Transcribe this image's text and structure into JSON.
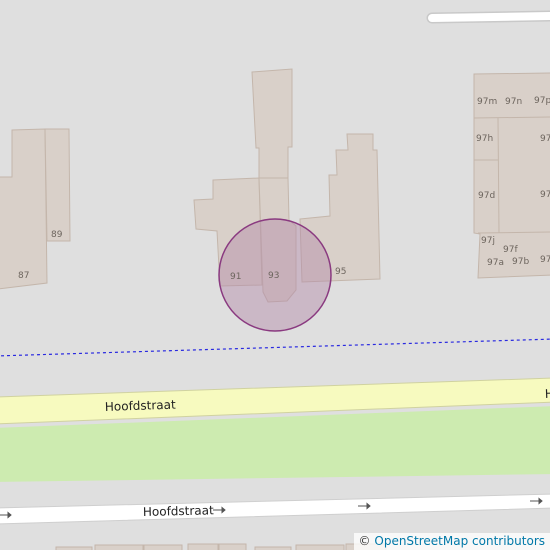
{
  "map": {
    "type": "street map",
    "colors": {
      "background": "#dfdfdf",
      "building_fill": "#d9d0c9",
      "building_stroke": "#c4b6ab",
      "main_road_fill": "#f7fabf",
      "main_road_stroke": "#d0d2a0",
      "grass": "#cdebb0",
      "minor_road": "#ffffff",
      "boundary_line": "#2a2ae0",
      "marker_fill": "#b48aa8",
      "marker_stroke": "#8a3a80"
    },
    "house_numbers": {
      "n87": "87",
      "n89": "89",
      "n91": "91",
      "n93": "93",
      "n95": "95",
      "n97m": "97m",
      "n97n": "97n",
      "n97p": "97p",
      "n97h": "97h",
      "n97d": "97d",
      "n97j": "97j",
      "n97f": "97f",
      "n97a": "97a",
      "n97b": "97b"
    },
    "streets": {
      "main": "Hoofdstraat",
      "main_right_fragment": "H",
      "lower": "Hoofdstraat"
    },
    "attribution": {
      "symbol": "©",
      "link_text": "OpenStreetMap contributors"
    }
  }
}
